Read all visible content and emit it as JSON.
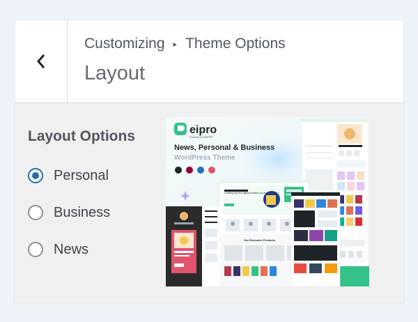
{
  "header": {
    "breadcrumb_root": "Customizing",
    "breadcrumb_separator": "▸",
    "breadcrumb_current": "Theme Options",
    "title": "Layout"
  },
  "layout_options": {
    "heading": "Layout Options",
    "selected": "Personal",
    "items": [
      {
        "label": "Personal",
        "checked": true
      },
      {
        "label": "Business",
        "checked": false
      },
      {
        "label": "News",
        "checked": false
      }
    ]
  },
  "preview": {
    "logo_text": "eipro",
    "logo_tagline": "Powered by ElitePHP",
    "headline": "News, Personal & Business",
    "subheadline": "WordPress Theme",
    "card_heading": "Creating the best digital solutions for your business",
    "products_heading": "Our Exclusive Products",
    "brand_color": "#35c28a",
    "accent_color": "#2271b1"
  }
}
